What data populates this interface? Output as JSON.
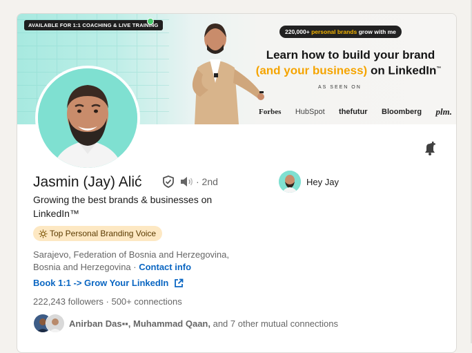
{
  "banner": {
    "availability_badge": "AVAILABLE FOR 1:1 COACHING & LIVE TRAINING",
    "growth_badge_prefix": "220,000+",
    "growth_badge_highlight": "personal brands",
    "growth_badge_suffix": "grow with me",
    "headline_line1": "Learn how to build your brand",
    "headline_line2_highlight": "(and your business)",
    "headline_line2_suffix": "on LinkedIn",
    "trademark": "™",
    "as_seen_on": "AS SEEN ON",
    "logos": [
      "Forbes",
      "HubSpot",
      "thefutur",
      "Bloomberg",
      "plm."
    ]
  },
  "profile": {
    "name": "Jasmin (Jay) Alić",
    "degree": "· 2nd",
    "headline": "Growing the best brands & businesses on LinkedIn™",
    "badge": "Top Personal Branding Voice",
    "location": "Sarajevo, Federation of Bosnia and Herzegovina, Bosnia and Herzegovina",
    "location_sep": " · ",
    "contact_info": "Contact info",
    "website_link": "Book 1:1 -> Grow Your LinkedIn",
    "followers": "222,243 followers",
    "connections": " · 500+ connections",
    "mutual_names": "Anirban Das▪▪, Muhammad Qaan,",
    "mutual_suffix": " and 7 other mutual connections"
  },
  "company": {
    "label": "Hey Jay"
  },
  "icons": {
    "verify": "shield-check-icon",
    "speaker": "speaker-icon",
    "bell": "bell-plus-icon",
    "external": "external-link-icon",
    "sun": "sun-icon"
  },
  "colors": {
    "link": "#0a66c2",
    "badge_bg": "#fde8c3",
    "accent_orange": "#f5a400",
    "teal": "#7fe0d1"
  }
}
